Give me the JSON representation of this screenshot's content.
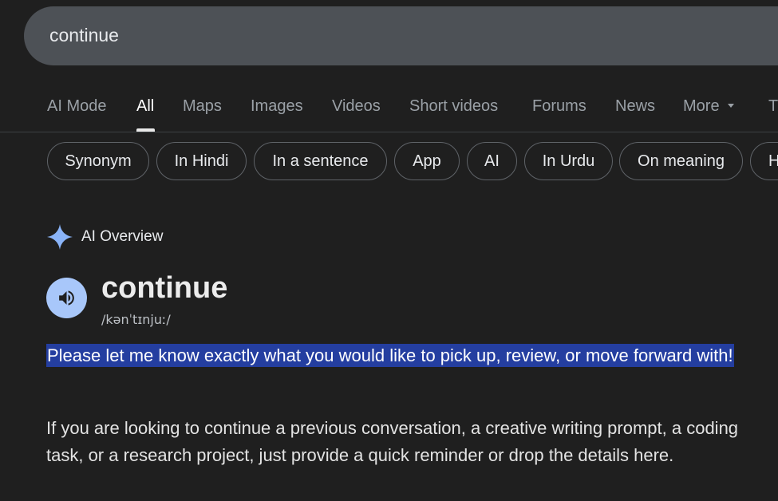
{
  "search": {
    "query": "continue"
  },
  "tabs": [
    {
      "label": "AI Mode",
      "active": false
    },
    {
      "label": "All",
      "active": true
    },
    {
      "label": "Maps",
      "active": false
    },
    {
      "label": "Images",
      "active": false
    },
    {
      "label": "Videos",
      "active": false
    },
    {
      "label": "Short videos",
      "active": false
    },
    {
      "label": "Forums",
      "active": false
    },
    {
      "label": "News",
      "active": false
    },
    {
      "label": "More",
      "active": false
    },
    {
      "label": "T",
      "active": false
    }
  ],
  "chips": [
    "Synonym",
    "In Hindi",
    "In a sentence",
    "App",
    "AI",
    "In Urdu",
    "On meaning",
    "H"
  ],
  "ai_overview": {
    "title": "AI Overview",
    "word": "continue",
    "phonetic": "/kənˈtɪnjuː/",
    "highlighted": "Please let me know exactly what you would like to pick up, review, or move forward with!",
    "body": "If you are looking to continue a previous conversation, a creative writing prompt, a coding task, or a research project, just provide a quick reminder or drop the details here."
  },
  "colors": {
    "background": "#1f1f1f",
    "search_bar": "#4d5156",
    "highlight": "#243ea0",
    "speaker_button": "#a8c7fa",
    "sparkle": "#8ab4f8"
  }
}
